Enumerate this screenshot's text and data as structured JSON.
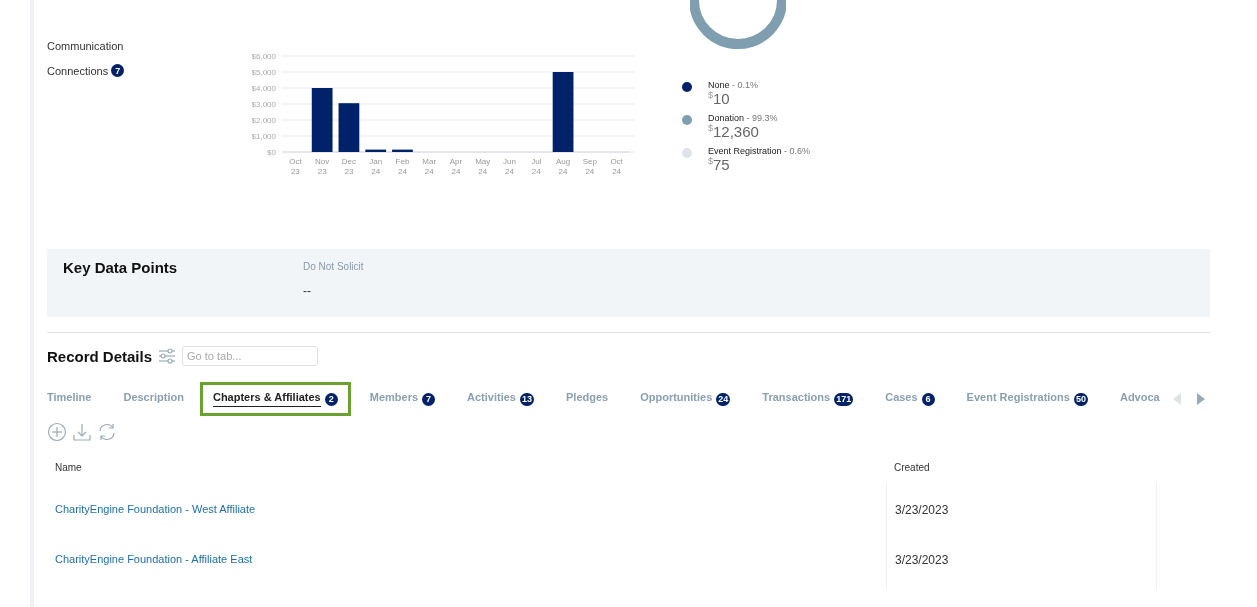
{
  "summary_links": [
    {
      "label": "Communication"
    },
    {
      "label": "Connections",
      "count": "7"
    }
  ],
  "giving_chart": {
    "chart_data": {
      "type": "bar",
      "categories": [
        "Oct 23",
        "Nov 23",
        "Dec 23",
        "Jan 24",
        "Feb 24",
        "Mar 24",
        "Apr 24",
        "May 24",
        "Jun 24",
        "Jul 24",
        "Aug 24",
        "Sep 24",
        "Oct 24"
      ],
      "grid": true,
      "series": [
        {
          "color": "#012169",
          "values": [
            0,
            4000,
            3050,
            150,
            150,
            0,
            0,
            0,
            0,
            0,
            5000,
            0,
            0
          ]
        }
      ],
      "ylim": [
        0,
        6000
      ],
      "yticks": [
        {
          "value": 0,
          "label": "$0"
        },
        {
          "value": 1000,
          "label": "$1,000"
        },
        {
          "value": 2000,
          "label": "$2,000"
        },
        {
          "value": 3000,
          "label": "$3,000"
        },
        {
          "value": 4000,
          "label": "$4,000"
        },
        {
          "value": 5000,
          "label": "$5,000"
        },
        {
          "value": 6000,
          "label": "$6,000"
        }
      ]
    }
  },
  "legend": [
    {
      "label": "None",
      "percent": "- 0.1%",
      "currency": "$",
      "amount": "10",
      "color": "#012169"
    },
    {
      "label": "Donation",
      "percent": "- 99.3%",
      "currency": "$",
      "amount": "12,360",
      "color": "#7f9fb0"
    },
    {
      "label": "Event Registration",
      "percent": "- 0.6%",
      "currency": "$",
      "amount": "75",
      "color": "#dde3e8"
    }
  ],
  "key_data_points": {
    "title": "Key Data Points",
    "fields": [
      {
        "label": "Do Not Solicit",
        "value": "--"
      }
    ]
  },
  "record_details": {
    "title": "Record Details",
    "search": {
      "placeholder": "Go to tab..."
    },
    "tabs": [
      {
        "label": "Timeline",
        "selected": false
      },
      {
        "label": "Description",
        "selected": false
      },
      {
        "label": "Chapters & Affiliates",
        "count": "2",
        "selected": true
      },
      {
        "label": "Members",
        "count": "7",
        "selected": false
      },
      {
        "label": "Activities",
        "count": "13",
        "selected": false
      },
      {
        "label": "Pledges",
        "selected": false
      },
      {
        "label": "Opportunities",
        "count": "24",
        "selected": false
      },
      {
        "label": "Transactions",
        "count": "171",
        "selected": false
      },
      {
        "label": "Cases",
        "count": "6",
        "selected": false
      },
      {
        "label": "Event Registrations",
        "count": "50",
        "selected": false
      },
      {
        "label": "Advoca",
        "selected": false
      }
    ],
    "table": {
      "columns": [
        "Name",
        "Created"
      ],
      "rows": [
        {
          "name": "CharityEngine Foundation - West Affiliate",
          "created": "3/23/2023"
        },
        {
          "name": "CharityEngine Foundation - Affiliate East",
          "created": "3/23/2023"
        }
      ]
    }
  }
}
